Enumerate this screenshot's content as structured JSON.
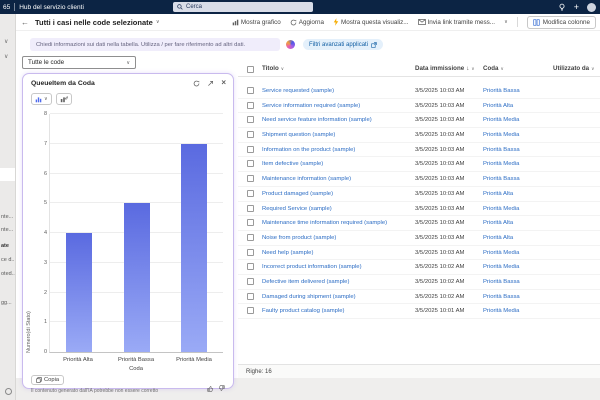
{
  "topbar": {
    "brand_fragment": "65",
    "app_name": "Hub del servizio clienti",
    "search_placeholder": "Cerca",
    "add_glyph": "+"
  },
  "command_bar": {
    "back_glyph": "←",
    "view_title": "Tutti i casi nelle code selezionate",
    "chevron": "∨",
    "commands": [
      {
        "label": "Mostra grafico",
        "icon": "bar-chart-icon"
      },
      {
        "label": "Aggiorna",
        "icon": "refresh-icon"
      },
      {
        "label": "Mostra questa visualiz...",
        "icon": "lightning-icon"
      },
      {
        "label": "Invia link tramite mess...",
        "icon": "email-icon"
      }
    ],
    "more_chevron": "∨",
    "edit_columns_label": "Modifica colonne"
  },
  "copilot_bar": {
    "placeholder": "Chiedi informazioni sui dati nella tabella. Utilizza / per fare riferimento ad altri dati.",
    "filter_pill_label": "Filtri avanzati applicati"
  },
  "queue_filter": {
    "value": "Tutte le code",
    "chevron": "∨"
  },
  "chart_panel": {
    "title": "QueueItem da Coda",
    "close_glyph": "×",
    "copy_label": "Copia",
    "disclaimer": "Il contenuto generato dall'IA potrebbe non essere corretto"
  },
  "chart_data": {
    "type": "bar",
    "title": "QueueItem da Coda",
    "categories": [
      "Priorità Alta",
      "Priorità Bassa",
      "Priorità Media"
    ],
    "values": [
      4,
      5,
      7
    ],
    "xlabel": "Coda",
    "ylabel": "Numero(di Stato)",
    "ylim": [
      0,
      8
    ],
    "yticks": [
      0,
      1,
      2,
      3,
      4,
      5,
      6,
      7,
      8
    ],
    "grid": true,
    "legend": false,
    "bar_color_top": "#5a6ae0",
    "bar_color_bottom": "#9aaaf6"
  },
  "table": {
    "columns": [
      {
        "label": "Titolo"
      },
      {
        "label": "Data immissione",
        "sort": "desc",
        "sort_glyph": "↓"
      },
      {
        "label": "Coda"
      },
      {
        "label": "Utilizzato da"
      }
    ],
    "header_chevron": "∨",
    "rows": [
      {
        "title": "Service requested (sample)",
        "date": "3/5/2025 10:03 AM",
        "queue": "Priorità Bassa",
        "used_by": ""
      },
      {
        "title": "Service information required (sample)",
        "date": "3/5/2025 10:03 AM",
        "queue": "Priorità Alta",
        "used_by": ""
      },
      {
        "title": "Need service feature information (sample)",
        "date": "3/5/2025 10:03 AM",
        "queue": "Priorità Media",
        "used_by": ""
      },
      {
        "title": "Shipment question (sample)",
        "date": "3/5/2025 10:03 AM",
        "queue": "Priorità Media",
        "used_by": ""
      },
      {
        "title": "Information on the product (sample)",
        "date": "3/5/2025 10:03 AM",
        "queue": "Priorità Bassa",
        "used_by": ""
      },
      {
        "title": "Item defective (sample)",
        "date": "3/5/2025 10:03 AM",
        "queue": "Priorità Media",
        "used_by": ""
      },
      {
        "title": "Maintenance information (sample)",
        "date": "3/5/2025 10:03 AM",
        "queue": "Priorità Bassa",
        "used_by": ""
      },
      {
        "title": "Product damaged (sample)",
        "date": "3/5/2025 10:03 AM",
        "queue": "Priorità Alta",
        "used_by": ""
      },
      {
        "title": "Required Service (sample)",
        "date": "3/5/2025 10:03 AM",
        "queue": "Priorità Media",
        "used_by": ""
      },
      {
        "title": "Maintenance time information required (sample)",
        "date": "3/5/2025 10:03 AM",
        "queue": "Priorità Alta",
        "used_by": ""
      },
      {
        "title": "Noise from product (sample)",
        "date": "3/5/2025 10:03 AM",
        "queue": "Priorità Alta",
        "used_by": ""
      },
      {
        "title": "Need help (sample)",
        "date": "3/5/2025 10:03 AM",
        "queue": "Priorità Media",
        "used_by": ""
      },
      {
        "title": "Incorrect product information (sample)",
        "date": "3/5/2025 10:02 AM",
        "queue": "Priorità Media",
        "used_by": ""
      },
      {
        "title": "Defective item delivered (sample)",
        "date": "3/5/2025 10:02 AM",
        "queue": "Priorità Bassa",
        "used_by": ""
      },
      {
        "title": "Damaged during shipment (sample)",
        "date": "3/5/2025 10:02 AM",
        "queue": "Priorità Bassa",
        "used_by": ""
      },
      {
        "title": "Faulty product catalog (sample)",
        "date": "3/5/2025 10:01 AM",
        "queue": "Priorità Media",
        "used_by": ""
      }
    ],
    "row_count_label": "Righe: 16"
  },
  "sidebar": {
    "fragments": [
      "nte...",
      "nte...",
      "ate",
      "ce d...",
      "oted...",
      "gg..."
    ]
  },
  "colors": {
    "topbar": "#0c2444",
    "link": "#2b6cc4",
    "panel_border": "#c9baee"
  }
}
